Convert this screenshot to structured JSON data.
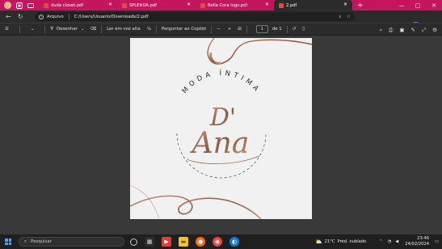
{
  "browser": {
    "tabs": [
      {
        "label": "duda closet.pdf",
        "active": false
      },
      {
        "label": "SPLENDA.pdf",
        "active": false
      },
      {
        "label": "Bella Cora logo.pdf",
        "active": false
      },
      {
        "label": "2.pdf",
        "active": true
      }
    ],
    "address": {
      "site_label": "Arquivo",
      "url": "C:/Users/Usuario/Downloads/2.pdf"
    }
  },
  "pdf_toolbar": {
    "draw_label": "Desenhar",
    "read_aloud_label": "Ler em voz alta",
    "ask_copilot_label": "Perguntar ao Copilot",
    "zoom_out": "−",
    "zoom_in": "+",
    "page_number": "1",
    "page_total": "de 1"
  },
  "document": {
    "arc_text": "MODA ÍNTIMA",
    "logo_initial": "D'",
    "logo_name": "Ana",
    "colors": {
      "page": "#f1f1f1",
      "copper": "#9a6a55",
      "copper_light": "#c99a7f",
      "text_dark": "#2a2a2a"
    }
  },
  "taskbar": {
    "search_placeholder": "Pesquisar",
    "weather_temp": "21°C",
    "weather_desc": "Pred. nublado",
    "time": "23:46",
    "date": "24/02/2024"
  },
  "colors": {
    "tabstrip": "#c5155f",
    "chrome_dark": "#2b2b2b",
    "viewer_bg": "#393939",
    "taskbar": "#1f1f1f"
  }
}
